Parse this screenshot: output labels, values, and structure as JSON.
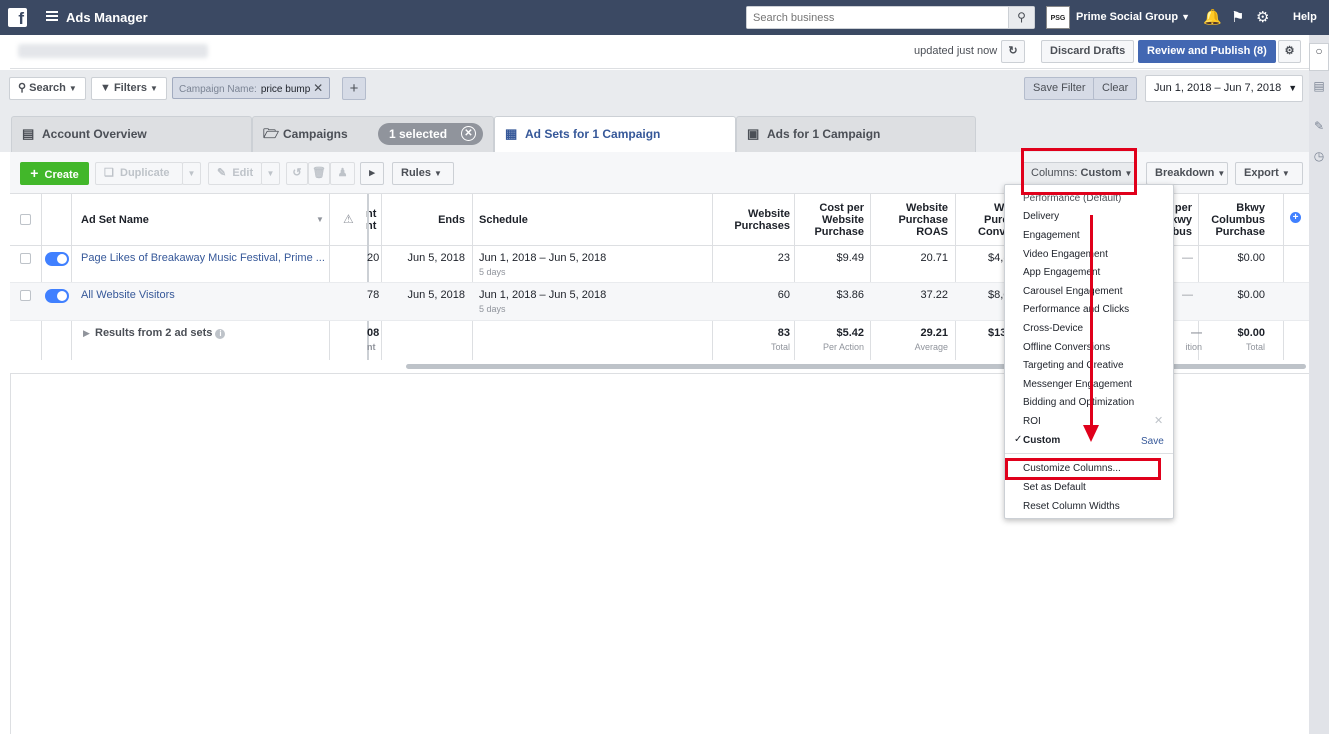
{
  "topbar": {
    "logo": "f",
    "title": "Ads Manager",
    "search_placeholder": "Search business",
    "business_badge": "PSG",
    "business_name": "Prime Social Group",
    "help": "Help"
  },
  "bar2": {
    "account_blurred": "Prime Social Group (398377339)",
    "updated": "updated just now",
    "discard": "Discard Drafts",
    "review": "Review and Publish (8)"
  },
  "filterbar": {
    "search": "Search",
    "filters": "Filters",
    "chip_label": "Campaign Name:",
    "chip_value": "price bump",
    "save_filter": "Save Filter",
    "clear": "Clear",
    "date_range": "Jun 1, 2018 – Jun 7, 2018"
  },
  "tabs": {
    "account": "Account Overview",
    "campaigns": "Campaigns",
    "selected": "1 selected",
    "adsets": "Ad Sets for 1 Campaign",
    "ads": "Ads for 1 Campaign"
  },
  "toolbar": {
    "create": "Create",
    "duplicate": "Duplicate",
    "edit": "Edit",
    "rules": "Rules",
    "columns_label": "Columns:",
    "columns_value": "Custom",
    "breakdown": "Breakdown",
    "export": "Export"
  },
  "grid": {
    "headers": {
      "name": "Ad Set Name",
      "cut_left_1": "nt",
      "cut_left_2": "nt",
      "ends": "Ends",
      "schedule": "Schedule",
      "website_purchases": [
        "Website",
        "Purchases"
      ],
      "cost_per": [
        "Cost per",
        "Website",
        "Purchase"
      ],
      "roas": [
        "Website",
        "Purchase",
        "ROAS"
      ],
      "conv": [
        "W",
        "Purc",
        "Conv"
      ],
      "cut_right": [
        "per",
        "kwy",
        "bus"
      ],
      "bkwy": [
        "Bkwy",
        "Columbus",
        "Purchase"
      ]
    },
    "rows": [
      {
        "name": "Page Likes of Breakaway Music Festival, Prime ...",
        "cut": "20",
        "ends": "Jun 5, 2018",
        "schedule": "Jun 1, 2018 – Jun 5, 2018",
        "schedule_sub": "5 days",
        "purchases": "23",
        "cost": "$9.49",
        "roas": "20.71",
        "conv": "$4,(",
        "dash": "—",
        "bkwy": "$0.00"
      },
      {
        "name": "All Website Visitors",
        "cut": "78",
        "ends": "Jun 5, 2018",
        "schedule": "Jun 1, 2018 – Jun 5, 2018",
        "schedule_sub": "5 days",
        "purchases": "60",
        "cost": "$3.86",
        "roas": "37.22",
        "conv": "$8,6",
        "dash": "—",
        "bkwy": "$0.00"
      }
    ],
    "summary": {
      "label": "Results from 2 ad sets",
      "cut": "08",
      "cut_sub": "nt",
      "purchases": "83",
      "purchases_sub": "Total",
      "cost": "$5.42",
      "cost_sub": "Per Action",
      "roas": "29.21",
      "roas_sub": "Average",
      "conv": "$13,1",
      "dash": "—",
      "dash_sub": "ition",
      "bkwy": "$0.00",
      "bkwy_sub": "Total"
    }
  },
  "menu": {
    "items": [
      "Performance (Default)",
      "Delivery",
      "Engagement",
      "Video Engagement",
      "App Engagement",
      "Carousel Engagement",
      "Performance and Clicks",
      "Cross-Device",
      "Offline Conversions",
      "Targeting and Creative",
      "Messenger Engagement",
      "Bidding and Optimization",
      "ROI"
    ],
    "custom": "Custom",
    "save": "Save",
    "customize": "Customize Columns...",
    "set_default": "Set as Default",
    "reset": "Reset Column Widths"
  },
  "colors": {
    "topbar": "#3b4963",
    "accent": "#4267b2",
    "create": "#42b72a",
    "annotation": "#e0001b"
  }
}
